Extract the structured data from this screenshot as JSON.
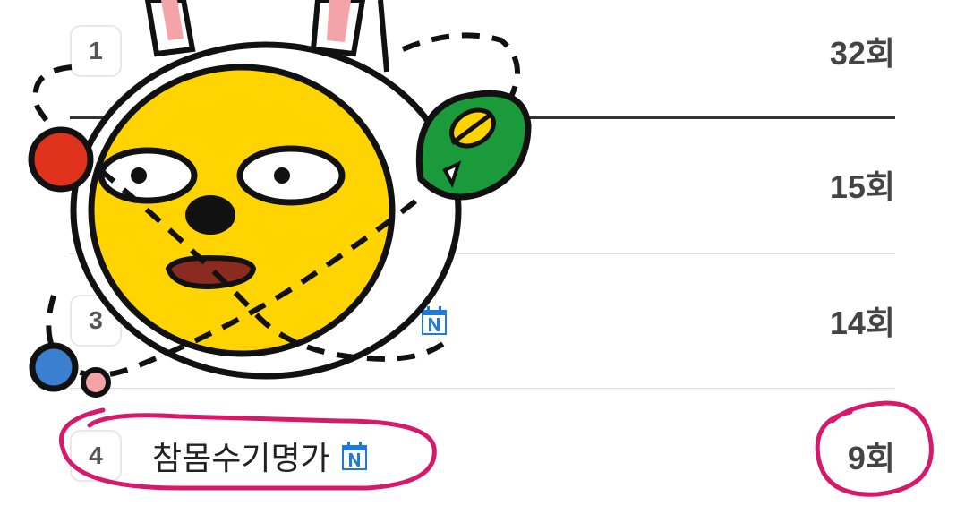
{
  "ranking": {
    "items": [
      {
        "rank": "1",
        "name": "",
        "count": "32회"
      },
      {
        "rank": "",
        "name": "",
        "count": "15회"
      },
      {
        "rank": "3",
        "name": "",
        "count": "14회"
      },
      {
        "rank": "4",
        "name": "참몸수기명가",
        "count": "9회"
      }
    ]
  },
  "icons": {
    "calendar_badge": "calendar-n-icon",
    "sticker": "rabbit-costume-character-sticker"
  },
  "colors": {
    "annotation": "#d61a6b",
    "badge_blue": "#1e7bd9",
    "sticker_yellow": "#ffd400",
    "sticker_green": "#1a9a3a",
    "sticker_red": "#e0331e",
    "sticker_blue": "#3a7fd0"
  }
}
